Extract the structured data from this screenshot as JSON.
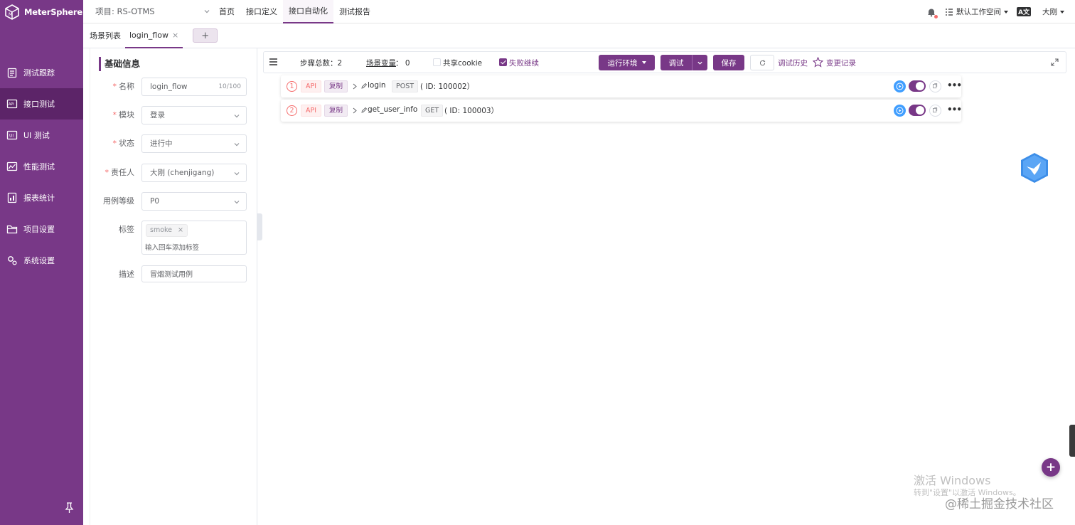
{
  "app": {
    "name": "MeterSphere"
  },
  "sidebar": {
    "items": [
      {
        "label": "测试跟踪",
        "icon": "clipboard-icon",
        "active": false
      },
      {
        "label": "接口测试",
        "icon": "api-icon",
        "active": true
      },
      {
        "label": "UI 测试",
        "icon": "ui-icon",
        "active": false
      },
      {
        "label": "性能测试",
        "icon": "chart-icon",
        "active": false
      },
      {
        "label": "报表统计",
        "icon": "report-icon",
        "active": false
      },
      {
        "label": "项目设置",
        "icon": "folder-icon",
        "active": false
      },
      {
        "label": "系统设置",
        "icon": "gear-icon",
        "active": false
      }
    ]
  },
  "topbar": {
    "project": "项目: RS-OTMS",
    "nav": [
      {
        "label": "首页",
        "active": false
      },
      {
        "label": "接口定义",
        "active": false
      },
      {
        "label": "接口自动化",
        "active": true
      },
      {
        "label": "测试报告",
        "active": false
      }
    ],
    "workspace": "默认工作空间",
    "lang": "A文",
    "user": "大刚"
  },
  "tabs": {
    "list_label": "场景列表",
    "active_tab": "login_flow",
    "close": "×",
    "add": "+"
  },
  "form": {
    "section_title": "基础信息",
    "name_label": "名称",
    "name_value": "login_flow",
    "name_count": "10/100",
    "module_label": "模块",
    "module_value": "登录",
    "status_label": "状态",
    "status_value": "进行中",
    "owner_label": "责任人",
    "owner_value": "大刚 (chenjigang)",
    "level_label": "用例等级",
    "level_value": "P0",
    "tags_label": "标签",
    "tag": "smoke",
    "tag_remove": "×",
    "tag_placeholder": "输入回车添加标签",
    "desc_label": "描述",
    "desc_value": "冒烟测试用例",
    "required_mark": "*"
  },
  "toolbar": {
    "steps_total": "步骤总数：2",
    "scene_vars": "场景变量",
    "scene_vars_count": "：  0",
    "share_cookie": "共享cookie",
    "share_cookie_checked": false,
    "continue_on_fail": "失败继续",
    "continue_on_fail_checked": true,
    "env_button": "运行环境",
    "debug_button": "调试",
    "save_button": "保存",
    "debug_history": "调试历史",
    "change_log": "变更记录"
  },
  "steps": [
    {
      "index": "1",
      "type": "API",
      "copy": "复制",
      "name": "login",
      "method": "POST",
      "id": "( ID: 100002）"
    },
    {
      "index": "2",
      "type": "API",
      "copy": "复制",
      "name": "get_user_info",
      "method": "GET",
      "id": "( ID: 100003）"
    }
  ],
  "watermark": {
    "windows_title": "激活 Windows",
    "windows_sub": "转到\"设置\"以激活 Windows。",
    "site": "@稀土掘金技术社区"
  },
  "fab": "+",
  "colors": {
    "brand": "#783887",
    "danger": "#f56c6c",
    "primary": "#409eff"
  }
}
